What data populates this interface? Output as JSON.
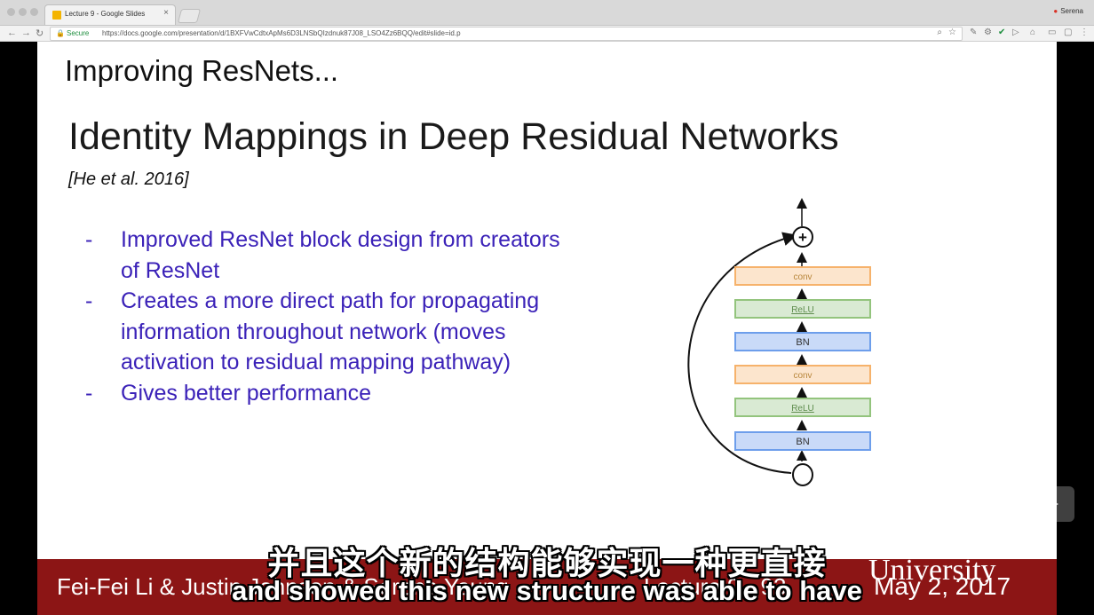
{
  "browser": {
    "tab_title": "Lecture 9 - Google Slides",
    "tab_close": "×",
    "profile": "Serena",
    "secure_label": "Secure",
    "url": "https://docs.google.com/presentation/d/1BXFVwCdtxApMs6D3LNSbQIzdnuk87J08_LSO4Zz6BQQ/edit#slide=id.p",
    "back_glyph": "←",
    "forward_glyph": "→",
    "reload_glyph": "↻"
  },
  "slide": {
    "title": "Improving ResNets...",
    "heading": "Identity Mappings in Deep Residual Networks",
    "citation": "[He et al. 2016]",
    "bullet_dash": "-",
    "bullets": [
      "Improved ResNet block design from creators of ResNet",
      "Creates a more direct path for propagating information throughout network (moves activation to residual mapping pathway)",
      "Gives better performance"
    ],
    "diagram": {
      "blocks": [
        "conv",
        "ReLU",
        "BN",
        "conv",
        "ReLU",
        "BN"
      ],
      "plus_symbol": "+",
      "colors": {
        "conv_fill": "#fce5cd",
        "conv_stroke": "#f6b26b",
        "relu_fill": "#d9ead3",
        "relu_stroke": "#93c47d",
        "bn_fill": "#c9daf8",
        "bn_stroke": "#6d9eeb"
      }
    }
  },
  "footer": {
    "names": "Fei-Fei Li & Justin Johnson & Serena Yeung",
    "lecture": "Lecture 9 - 93",
    "date": "May 2, 2017",
    "university": "University",
    "color": "#8c1515"
  },
  "subtitles": {
    "chinese": "并且这个新的结构能够实现一种更直接",
    "english": "and showed this new structure was able to have"
  }
}
